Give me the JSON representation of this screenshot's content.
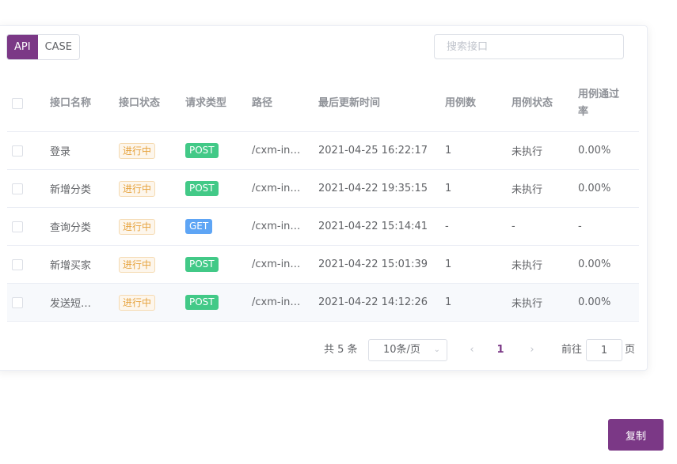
{
  "tabs": [
    {
      "label": "API",
      "active": true
    },
    {
      "label": "CASE",
      "active": false
    }
  ],
  "search": {
    "placeholder": "搜索接口",
    "value": ""
  },
  "table": {
    "headers": [
      "接口名称",
      "接口状态",
      "请求类型",
      "路径",
      "最后更新时间",
      "用例数",
      "用例状态",
      "用例通过率"
    ],
    "rows": [
      {
        "name": "登录",
        "status": "进行中",
        "method": "POST",
        "path": "/cxm-in…",
        "updated": "2021-04-25 16:22:17",
        "cases": "1",
        "case_status": "未执行",
        "pass_rate": "0.00%"
      },
      {
        "name": "新增分类",
        "status": "进行中",
        "method": "POST",
        "path": "/cxm-in…",
        "updated": "2021-04-22 19:35:15",
        "cases": "1",
        "case_status": "未执行",
        "pass_rate": "0.00%"
      },
      {
        "name": "查询分类",
        "status": "进行中",
        "method": "GET",
        "path": "/cxm-in…",
        "updated": "2021-04-22 15:14:41",
        "cases": "-",
        "case_status": "-",
        "pass_rate": "-"
      },
      {
        "name": "新增买家",
        "status": "进行中",
        "method": "POST",
        "path": "/cxm-in…",
        "updated": "2021-04-22 15:01:39",
        "cases": "1",
        "case_status": "未执行",
        "pass_rate": "0.00%"
      },
      {
        "name": "发送短…",
        "status": "进行中",
        "method": "POST",
        "path": "/cxm-in…",
        "updated": "2021-04-22 14:12:26",
        "cases": "1",
        "case_status": "未执行",
        "pass_rate": "0.00%"
      }
    ]
  },
  "pagination": {
    "total": "共 5 条",
    "page_size": "10条/页",
    "current_page": "1",
    "goto_label": "前往",
    "goto_value": "1",
    "goto_suffix": "页"
  },
  "copy_button": {
    "label": "复制"
  },
  "icons": {
    "prev": "chevron-left-icon",
    "next": "chevron-right-icon",
    "select": "chevron-down-icon"
  },
  "colors": {
    "accent": "#7b3886",
    "post": "#42c987",
    "get": "#5ea5f5",
    "warn": "#e6a23c"
  }
}
